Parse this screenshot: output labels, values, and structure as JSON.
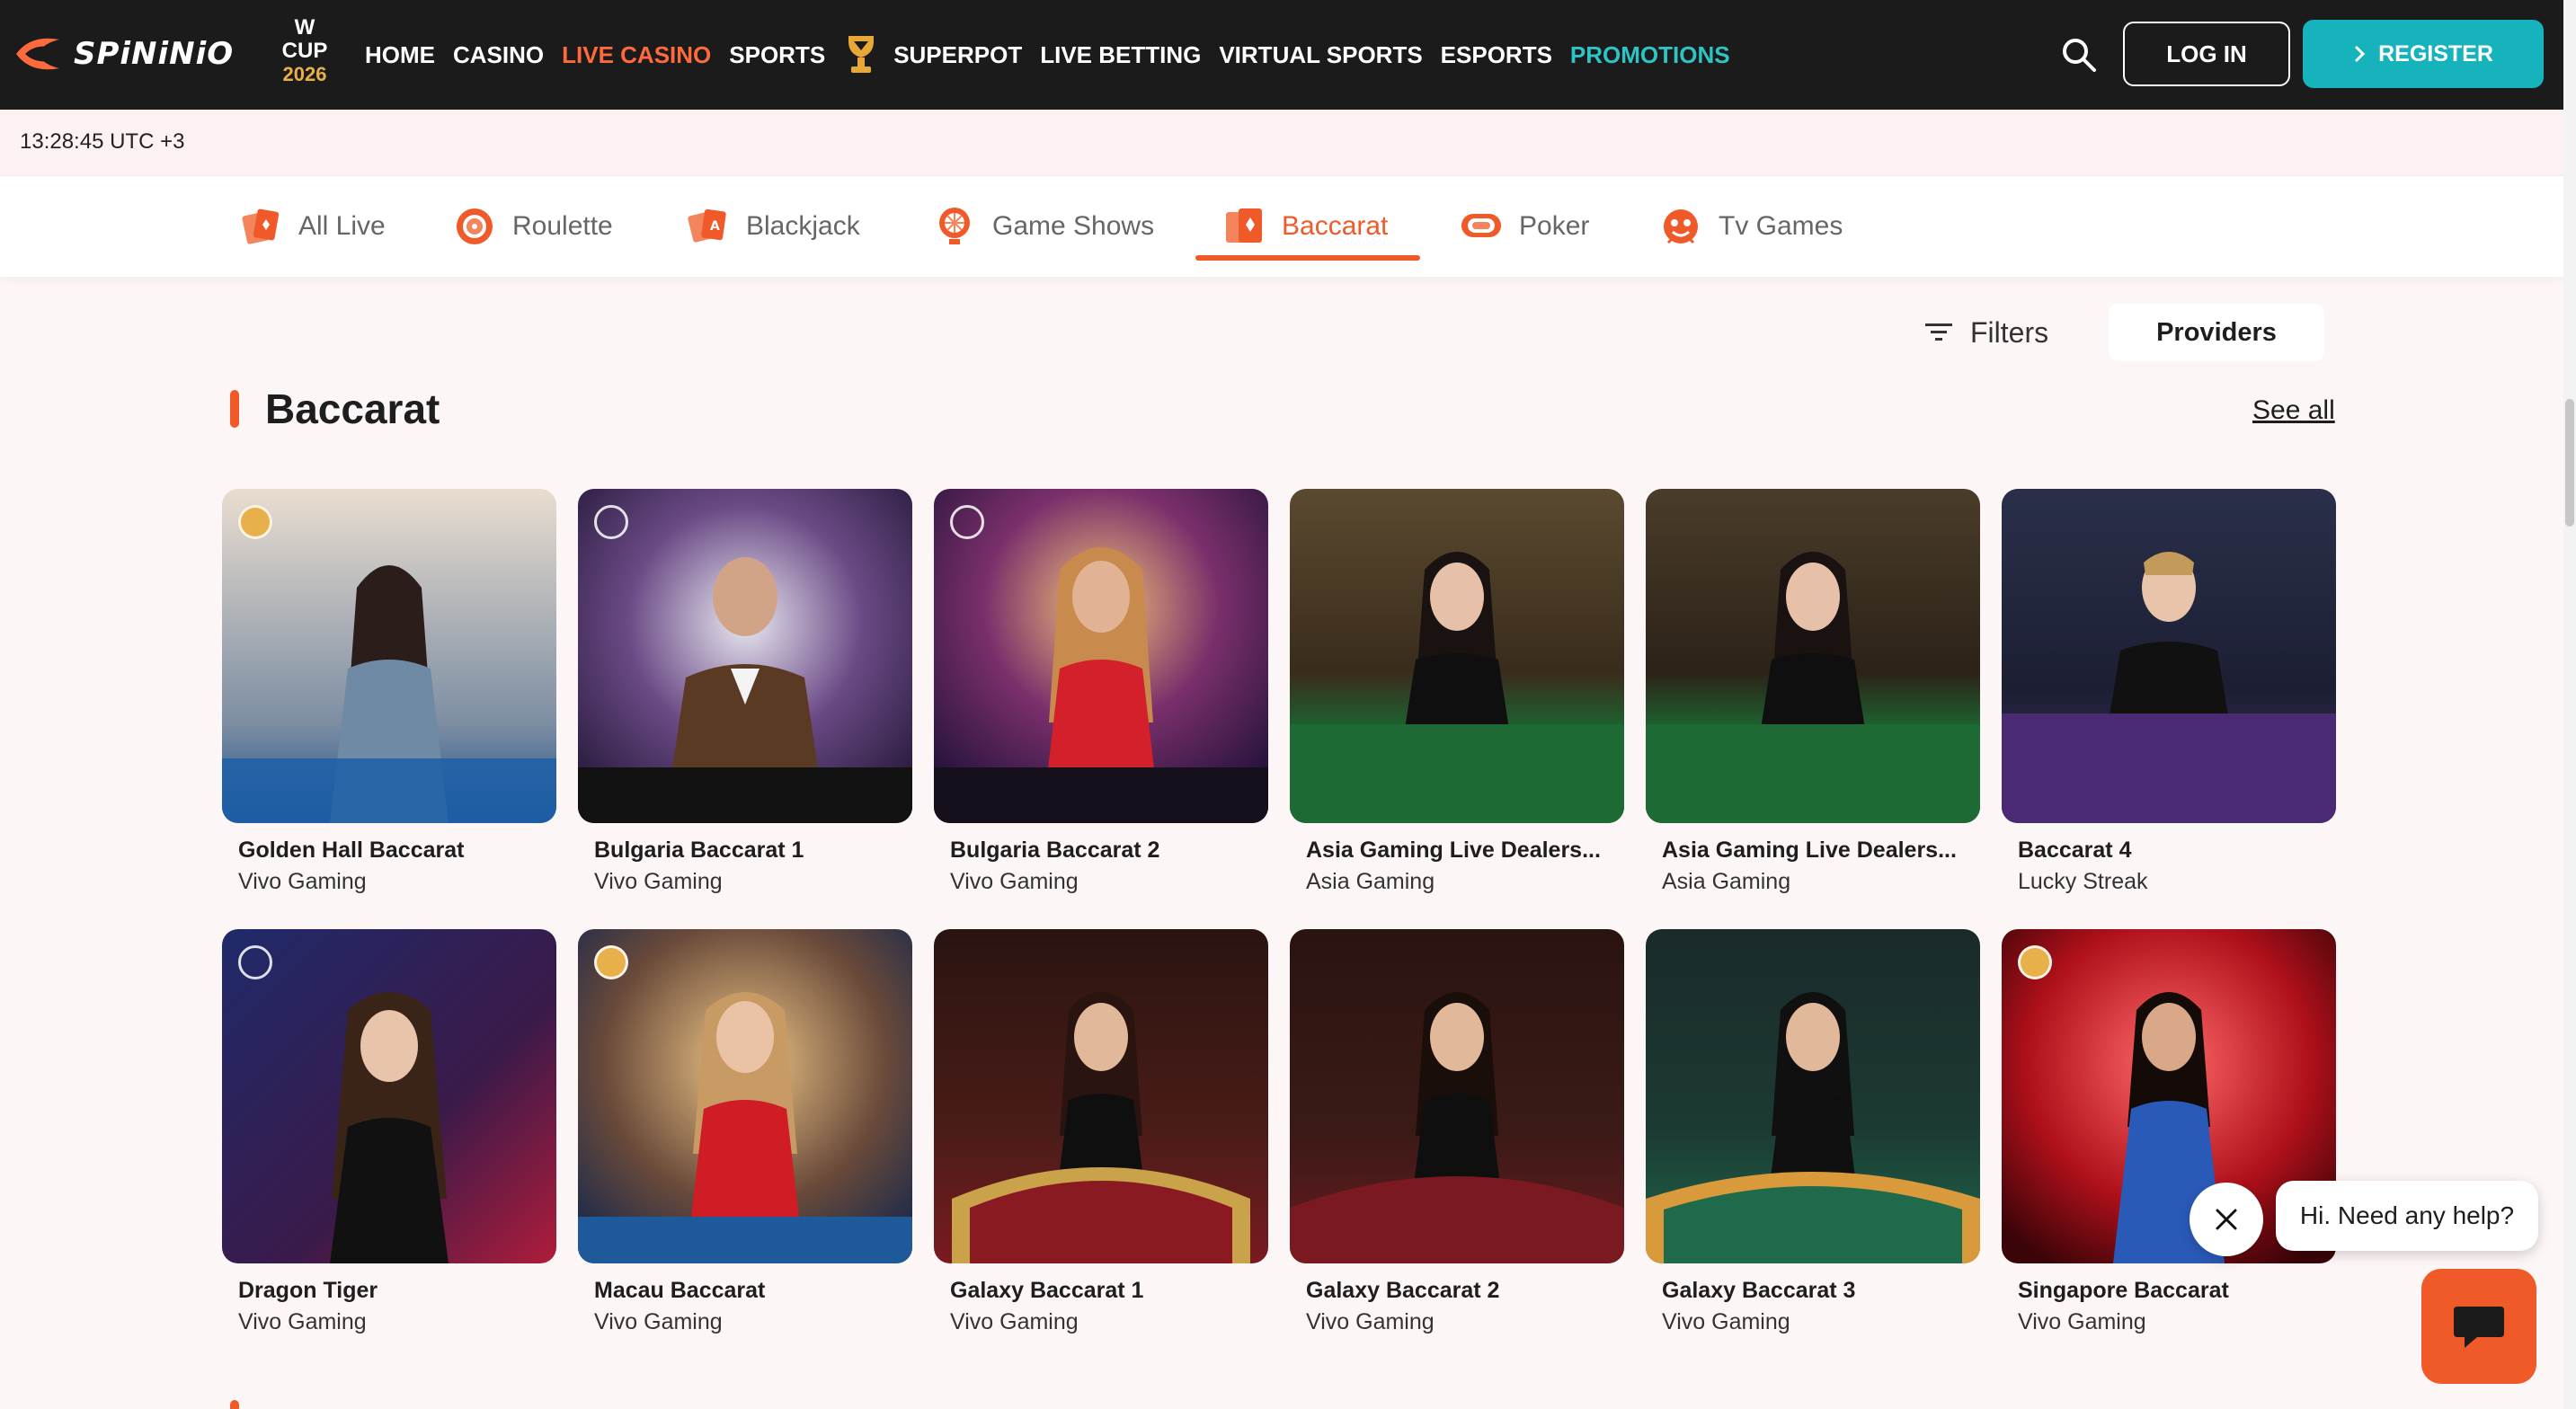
{
  "header": {
    "logo_text": "SPiNiNiO",
    "wcup": {
      "line1": "W",
      "line2": "CUP",
      "year": "2026"
    },
    "nav": [
      {
        "label": "HOME"
      },
      {
        "label": "CASINO"
      },
      {
        "label": "LIVE CASINO"
      },
      {
        "label": "SPORTS"
      },
      {
        "label": "SUPERPOT"
      },
      {
        "label": "LIVE BETTING"
      },
      {
        "label": "VIRTUAL SPORTS"
      },
      {
        "label": "ESPORTS"
      },
      {
        "label": "PROMOTIONS"
      }
    ],
    "login_label": "LOG IN",
    "register_label": "REGISTER",
    "colors": {
      "bg": "#1b1b1b",
      "active": "#ff6a3d",
      "promo": "#2ec4c4",
      "register": "#17b3bd"
    }
  },
  "clock": "13:28:45 UTC +3",
  "tabs": [
    {
      "label": "All Live",
      "icon": "cards-icon"
    },
    {
      "label": "Roulette",
      "icon": "roulette-icon"
    },
    {
      "label": "Blackjack",
      "icon": "blackjack-icon"
    },
    {
      "label": "Game Shows",
      "icon": "wheel-icon"
    },
    {
      "label": "Baccarat",
      "icon": "baccarat-icon",
      "active": true
    },
    {
      "label": "Poker",
      "icon": "chip-icon"
    },
    {
      "label": "Tv Games",
      "icon": "tv-games-icon"
    }
  ],
  "toolbar": {
    "filters_label": "Filters",
    "providers_label": "Providers"
  },
  "section": {
    "title": "Baccarat",
    "see_all": "See all"
  },
  "games": [
    {
      "name": "Golden Hall Baccarat",
      "provider": "Vivo Gaming"
    },
    {
      "name": "Bulgaria Baccarat 1",
      "provider": "Vivo Gaming"
    },
    {
      "name": "Bulgaria Baccarat 2",
      "provider": "Vivo Gaming"
    },
    {
      "name": "Asia Gaming Live Dealers...",
      "provider": "Asia Gaming"
    },
    {
      "name": "Asia Gaming Live Dealers...",
      "provider": "Asia Gaming"
    },
    {
      "name": "Baccarat 4",
      "provider": "Lucky Streak"
    },
    {
      "name": "Dragon Tiger",
      "provider": "Vivo Gaming"
    },
    {
      "name": "Macau Baccarat",
      "provider": "Vivo Gaming"
    },
    {
      "name": "Galaxy Baccarat 1",
      "provider": "Vivo Gaming"
    },
    {
      "name": "Galaxy Baccarat 2",
      "provider": "Vivo Gaming"
    },
    {
      "name": "Galaxy Baccarat 3",
      "provider": "Vivo Gaming"
    },
    {
      "name": "Singapore Baccarat",
      "provider": "Vivo Gaming"
    }
  ],
  "chat": {
    "message": "Hi. Need any help?"
  },
  "accent": "#f05a28"
}
